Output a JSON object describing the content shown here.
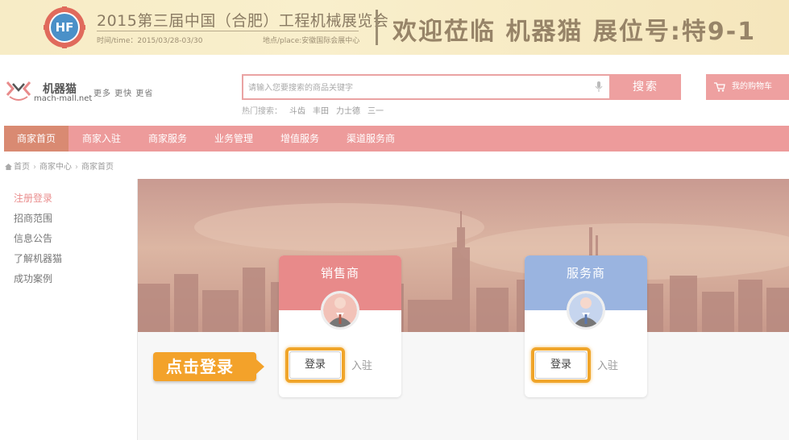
{
  "banner": {
    "logo_text": "HF",
    "title": "2015第三届中国（合肥）工程机械展览会",
    "time": "时间/time：2015/03/28-03/30",
    "place": "地点/place:安徽国际会展中心",
    "welcome": "欢迎莅临 机器猫  展位号:特9-1"
  },
  "header": {
    "logo_name": "机器猫",
    "logo_domain": "mach-mall.net",
    "slogan": "更多 更快 更省",
    "search_placeholder": "请输入您要搜索的商品关键字",
    "search_button": "搜索",
    "hot_label": "热门搜索：",
    "hot_terms": [
      "斗齿",
      "丰田",
      "力士德",
      "三一"
    ],
    "cart_label": "我的购物车"
  },
  "nav": {
    "items": [
      "商家首页",
      "商家入驻",
      "商家服务",
      "业务管理",
      "增值服务",
      "渠道服务商"
    ]
  },
  "breadcrumb": {
    "items": [
      "首页",
      "商家中心",
      "商家首页"
    ]
  },
  "sidebar": {
    "items": [
      "注册登录",
      "招商范围",
      "信息公告",
      "了解机器猫",
      "成功案例"
    ]
  },
  "cards": [
    {
      "title": "销售商",
      "login": "登录",
      "join": "入驻",
      "color": "#e88a8a"
    },
    {
      "title": "服务商",
      "login": "登录",
      "join": "入驻",
      "color": "#9ab4e0"
    }
  ],
  "callout": {
    "text": "点击登录"
  },
  "colors": {
    "accent": "#ed9b9b",
    "nav_active": "#d98a72",
    "highlight": "#f3a22a"
  }
}
